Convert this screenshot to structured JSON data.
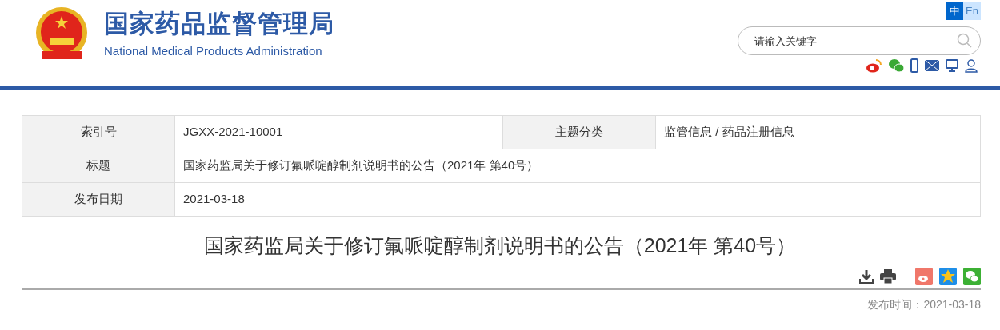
{
  "header": {
    "title": "国家药品监督管理局",
    "subtitle": "National Medical Products Administration"
  },
  "languages": [
    {
      "label": "中",
      "selected": true
    },
    {
      "label": "En",
      "selected": false
    }
  ],
  "search": {
    "placeholder": "请输入关键字"
  },
  "info_table": {
    "rows": [
      {
        "cells": [
          {
            "kind": "label",
            "text": "索引号"
          },
          {
            "kind": "value",
            "text": "JGXX-2021-10001"
          },
          {
            "kind": "label",
            "text": "主题分类"
          },
          {
            "kind": "value",
            "text": "监管信息 / 药品注册信息"
          }
        ]
      },
      {
        "cells": [
          {
            "kind": "label",
            "text": "标题"
          },
          {
            "kind": "value",
            "text": "国家药监局关于修订氟哌啶醇制剂说明书的公告（2021年 第40号）"
          }
        ]
      },
      {
        "cells": [
          {
            "kind": "label",
            "text": "发布日期"
          },
          {
            "kind": "value",
            "text": "2021-03-18"
          }
        ]
      }
    ]
  },
  "article": {
    "title": "国家药监局关于修订氟哌啶醇制剂说明书的公告（2021年 第40号）",
    "publish_time": "发布时间：2021-03-18"
  }
}
